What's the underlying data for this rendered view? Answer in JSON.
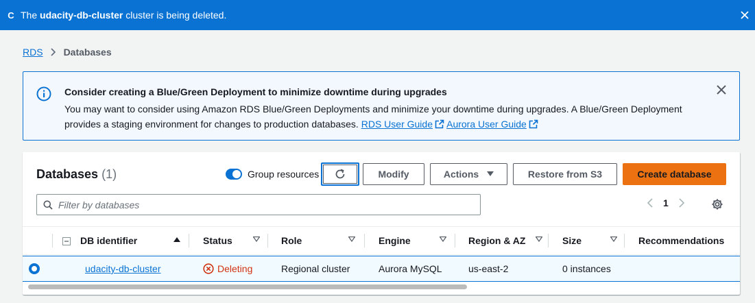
{
  "flash": {
    "status_glyph": "C",
    "resource": "udacity-db-cluster",
    "message": " cluster is being deleted."
  },
  "breadcrumb": {
    "root": "RDS",
    "current": "Databases"
  },
  "info": {
    "title": "Consider creating a Blue/Green Deployment to minimize downtime during upgrades",
    "body": "You may want to consider using Amazon RDS Blue/Green Deployments and minimize your downtime during upgrades. A Blue/Green Deployment provides a staging environment for changes to production databases. ",
    "link1": "RDS User Guide",
    "link2": "Aurora User Guide"
  },
  "panel": {
    "title": "Databases",
    "count": "(1)",
    "group_label": "Group resources",
    "group_enabled": true,
    "buttons": {
      "modify": "Modify",
      "actions": "Actions",
      "restore": "Restore from S3",
      "create": "Create database"
    },
    "filter_placeholder": "Filter by databases",
    "page": "1"
  },
  "table": {
    "headers": {
      "identifier": "DB identifier",
      "status": "Status",
      "role": "Role",
      "engine": "Engine",
      "region": "Region & AZ",
      "size": "Size",
      "recommendations": "Recommendations"
    },
    "rows": [
      {
        "identifier": "udacity-db-cluster",
        "status": "Deleting",
        "role": "Regional cluster",
        "engine": "Aurora MySQL",
        "region": "us-east-2",
        "size": "0 instances",
        "recommendations": ""
      }
    ]
  },
  "colors": {
    "primary": "#0972d3",
    "create_button": "#ec7211",
    "error": "#d13212"
  }
}
